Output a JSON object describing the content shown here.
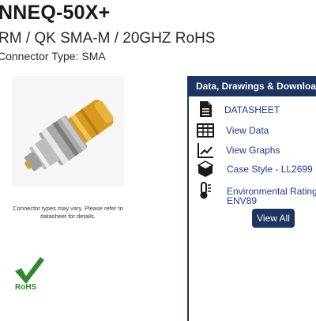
{
  "product": {
    "title": "NNEQ-50X+",
    "subtitle": "RM / QK SMA-M / 20GHZ RoHS",
    "connector_type": "Connector Type: SMA",
    "image_note": "Connector types may vary. Please refer to datasheet for details.",
    "rohs_badge": "RoHS"
  },
  "panel": {
    "heading": "Data, Drawings & Downloads",
    "items": [
      {
        "label": "DATASHEET",
        "icon": "document-icon"
      },
      {
        "label": "View Data",
        "icon": "table-icon"
      },
      {
        "label": "View Graphs",
        "icon": "line-chart-icon"
      },
      {
        "label": "Case Style - LL2699",
        "icon": "cube-icon"
      },
      {
        "label_line1": "Environmental Rating -",
        "label_line2": "ENV89",
        "icon": "thermometer-icon"
      }
    ],
    "view_all": "View All"
  },
  "colors": {
    "accent": "#1e3461",
    "link": "#1e3a8a",
    "rohs_green": "#2e8b2e"
  }
}
